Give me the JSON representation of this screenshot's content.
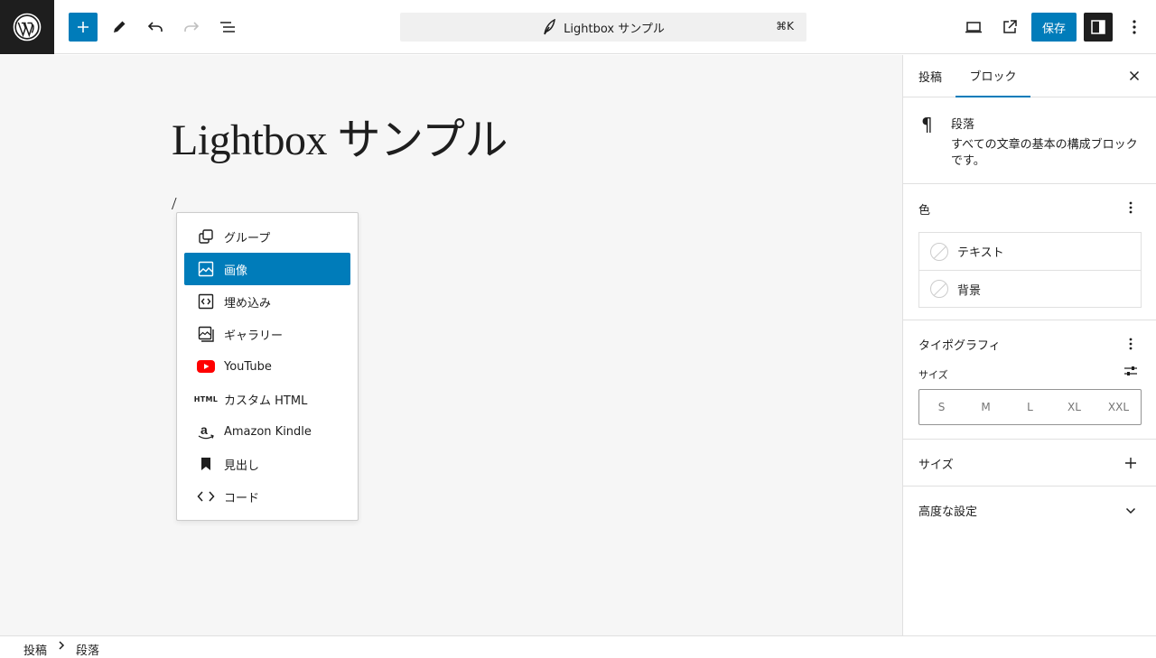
{
  "header": {
    "document_title": "Lightbox サンプル",
    "shortcut": "⌘K",
    "save_label": "保存"
  },
  "editor": {
    "post_title": "Lightbox サンプル",
    "slash_input": "/"
  },
  "inserter": {
    "items": [
      {
        "label": "グループ",
        "icon": "group-icon"
      },
      {
        "label": "画像",
        "icon": "image-icon",
        "selected": true
      },
      {
        "label": "埋め込み",
        "icon": "embed-icon"
      },
      {
        "label": "ギャラリー",
        "icon": "gallery-icon"
      },
      {
        "label": "YouTube",
        "icon": "youtube-icon"
      },
      {
        "label": "カスタム HTML",
        "icon": "html-icon",
        "icon_text": "HTML"
      },
      {
        "label": "Amazon Kindle",
        "icon": "amazon-icon"
      },
      {
        "label": "見出し",
        "icon": "bookmark-icon"
      },
      {
        "label": "コード",
        "icon": "code-icon"
      }
    ]
  },
  "sidebar": {
    "tabs": [
      "投稿",
      "ブロック"
    ],
    "active_tab": "ブロック",
    "block": {
      "name": "段落",
      "description": "すべての文章の基本の構成ブロックです。"
    },
    "color_panel": {
      "title": "色",
      "items": [
        "テキスト",
        "背景"
      ]
    },
    "typography_panel": {
      "title": "タイポグラフィ",
      "size_label": "サイズ",
      "sizes": [
        "S",
        "M",
        "L",
        "XL",
        "XXL"
      ]
    },
    "dimensions_panel": {
      "title": "サイズ"
    },
    "advanced_panel": {
      "title": "高度な設定"
    }
  },
  "footer": {
    "breadcrumbs": [
      "投稿",
      "段落"
    ]
  },
  "colors": {
    "accent": "#007cba",
    "dark": "#1e1e1e",
    "youtube_red": "#ff0000"
  }
}
